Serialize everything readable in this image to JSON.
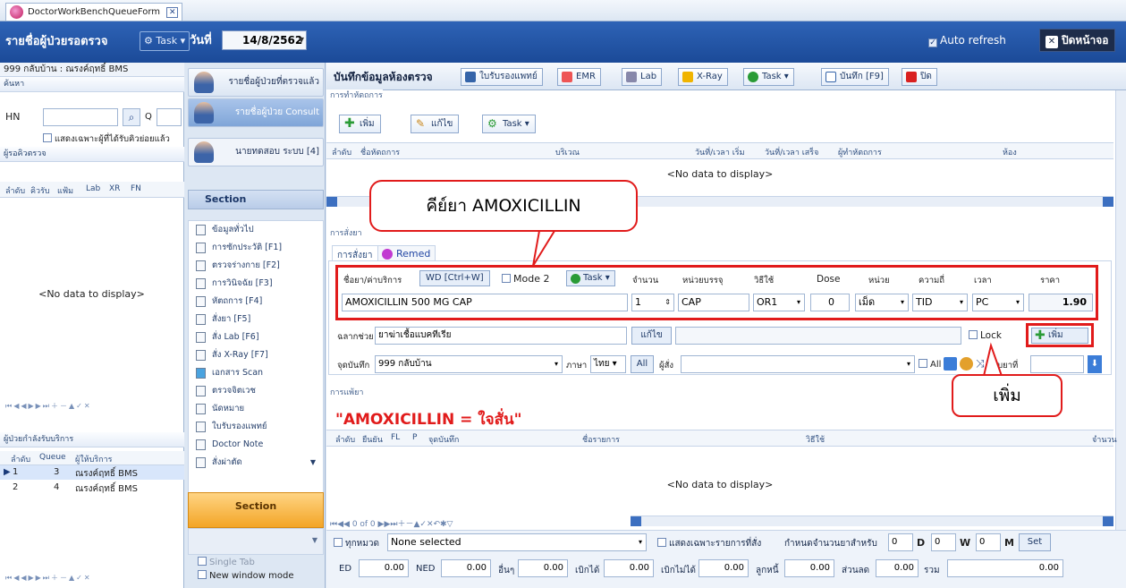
{
  "doc_tab": {
    "label": "DoctorWorkBenchQueueForm"
  },
  "titlebar": {
    "title": "รายชื่อผู้ป่วยรอตรวจ",
    "task": "Task",
    "date_label": "วันที่",
    "date": "14/8/2562",
    "auto_refresh": "Auto refresh",
    "close": "ปิดหน้าจอ"
  },
  "left": {
    "clinic": "999 กลับบ้าน : ณรงค์ฤทธิ์ BMS",
    "search_group": "ค้นหา",
    "hn_label": "HN",
    "q_label": "Q",
    "only_self": "แสดงเฉพาะผู้ที่ได้รับคิวย่อยแล้ว",
    "wait_group": "ผู้รอคิวตรวจ",
    "wait_cols": [
      "ลำดับ",
      "คิวรับ",
      "แฟ้ม",
      "Lab",
      "XR",
      "FN"
    ],
    "no_data": "<No data to display>",
    "service_group": "ผู้ป่วยกำลังรับบริการ",
    "service_cols": [
      "ลำดับ",
      "Queue",
      "ผู้ให้บริการ"
    ],
    "service_rows": [
      {
        "no": "1",
        "queue": "3",
        "provider": "ณรงค์ฤทธิ์ BMS"
      },
      {
        "no": "2",
        "queue": "4",
        "provider": "ณรงค์ฤทธิ์ BMS"
      }
    ]
  },
  "mid": {
    "btn_examined": "รายชื่อผู้ป่วยที่ตรวจแล้ว",
    "btn_consult": "รายชื่อผู้ป่วย Consult",
    "btn_user": "นายทดสอบ ระบบ [4]",
    "section": "Section",
    "menu": [
      "ข้อมูลทั่วไป",
      "การซักประวัติ [F1]",
      "ตรวจร่างกาย [F2]",
      "การวินิจฉัย [F3]",
      "หัตถการ [F4]",
      "สั่งยา [F5]",
      "สั่ง Lab [F6]",
      "สั่ง X-Ray [F7]",
      "เอกสาร Scan",
      "ตรวจจิตเวช",
      "นัดหมาย",
      "ใบรับรองแพทย์",
      "Doctor Note",
      "สั่งผ่าตัด"
    ],
    "section_bottom": "Section",
    "single_tab": "Single Tab",
    "new_window": "New window mode"
  },
  "toolbar": {
    "title": "บันทึกข้อมูลห้องตรวจ",
    "cert": "ใบรับรองแพทย์",
    "emr": "EMR",
    "lab": "Lab",
    "xray": "X-Ray",
    "task": "Task",
    "save": "บันทึก [F9]",
    "close": "ปิด"
  },
  "procedure": {
    "group": "การทำหัตถการ",
    "add": "เพิ่ม",
    "edit": "แก้ไข",
    "task": "Task",
    "cols": [
      "ลำดับ",
      "ชื่อหัตถการ",
      "บริเวณ",
      "วันที่/เวลา เริ่ม",
      "วันที่/เวลา เสร็จ",
      "ผู้ทำหัตถการ",
      "ห้อง"
    ],
    "no_data": "<No data to display>"
  },
  "order": {
    "group": "การสั่งยา",
    "tab": "การสั่งยา",
    "remed": "Remed",
    "drug_label": "ชื่อยา/ค่าบริการ",
    "wd_button": "WD [Ctrl+W]",
    "mode2": "Mode 2",
    "task": "Task",
    "qty_label": "จำนวน",
    "unit_pack_label": "หน่วยบรรจุ",
    "usage_label": "วิธีใช้",
    "dose_label": "Dose",
    "unit_label": "หน่วย",
    "freq_label": "ความถี่",
    "time_label": "เวลา",
    "price_label": "ราคา",
    "drug_value": "AMOXICILLIN 500 MG CAP",
    "qty": "1",
    "unit_pack": "CAP",
    "usage": "OR1",
    "dose": "0",
    "unit": "เม็ด",
    "freq": "TID",
    "time": "PC",
    "price": "1.90",
    "aux_label": "ฉลากช่วย",
    "aux_value": "ยาฆ่าเชื้อแบคทีเรีย",
    "aux_edit": "แก้ไข",
    "lock": "Lock",
    "add": "เพิ่ม",
    "save_point_label": "จุดบันทึก",
    "save_point": "999 กลับบ้าน",
    "lang_label": "ภาษา",
    "lang": "ไทย",
    "all": "All",
    "orderer_label": "ผู้สั่ง",
    "all2": "All",
    "receive_label": "รับยาที่"
  },
  "allergy": {
    "group": "การแพ้ยา",
    "alert": "\"AMOXICILLIN = ใจสั่น\"",
    "cols": [
      "ลำดับ",
      "ยืนยัน",
      "FL",
      "P",
      "จุดบันทึก",
      "ชื่อรายการ",
      "วิธีใช้",
      "จำนวน"
    ],
    "no_data": "<No data to display>",
    "nav": "0 of 0"
  },
  "footer": {
    "all_cat": "ทุกหมวด",
    "none_sel": "None selected",
    "only_ordered": "แสดงเฉพาะรายการที่สั่ง",
    "days_label": "กำหนดจำนวนยาสำหรับ",
    "d_val": "0",
    "d": "D",
    "w_val": "0",
    "w": "W",
    "m_val": "0",
    "m": "M",
    "set": "Set",
    "ed_label": "ED",
    "ed": "0.00",
    "ned_label": "NED",
    "ned": "0.00",
    "other_label": "อื่นๆ",
    "other": "0.00",
    "claim_label": "เบิกได้",
    "claim": "0.00",
    "noclaim_label": "เบิกไม่ได้",
    "noclaim": "0.00",
    "debt_label": "ลูกหนี้",
    "debt": "0.00",
    "discount_label": "ส่วนลด",
    "discount": "0.00",
    "total_label": "รวม",
    "total": "0.00"
  },
  "callouts": {
    "top": "คีย์ยา AMOXICILLIN",
    "add": "เพิ่ม"
  }
}
